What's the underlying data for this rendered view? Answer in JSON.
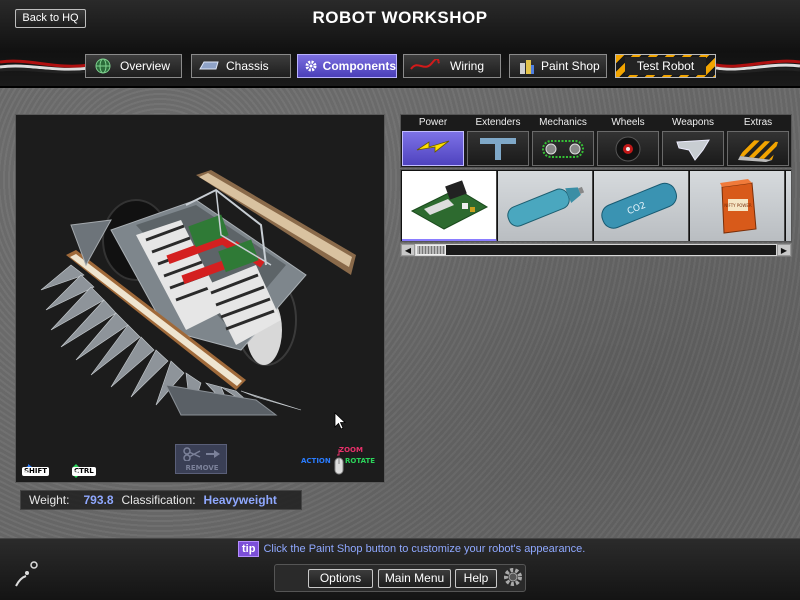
{
  "header": {
    "back_label": "Back to HQ",
    "title": "ROBOT WORKSHOP"
  },
  "tabs": [
    {
      "label": "Overview",
      "icon": "globe-icon"
    },
    {
      "label": "Chassis",
      "icon": "chassis-icon"
    },
    {
      "label": "Components",
      "icon": "gear-icon",
      "active": true
    },
    {
      "label": "Wiring",
      "icon": "wire-icon"
    },
    {
      "label": "Paint Shop",
      "icon": "paint-cans-icon"
    },
    {
      "label": "Test Robot",
      "icon": "hazard-stripes"
    }
  ],
  "viewport": {
    "shift_key": "SHIFT",
    "ctrl_key": "CTRL",
    "remove_label": "REMOVE",
    "action_label": "ACTION",
    "zoom_label": "ZOOM",
    "rotate_label": "ROTATE"
  },
  "stats": {
    "weight_label": "Weight:",
    "weight_value": "793.8",
    "class_label": "Classification:",
    "class_value": "Heavyweight"
  },
  "categories": [
    {
      "label": "Power",
      "icon": "lightning-icon",
      "active": true
    },
    {
      "label": "Extenders",
      "icon": "t-bar-icon"
    },
    {
      "label": "Mechanics",
      "icon": "chain-drive-icon"
    },
    {
      "label": "Wheels",
      "icon": "wheel-icon"
    },
    {
      "label": "Weapons",
      "icon": "blade-icon"
    },
    {
      "label": "Extras",
      "icon": "hazard-plate-icon"
    }
  ],
  "parts": [
    {
      "name": "circuit-board-part",
      "selected": true
    },
    {
      "name": "blue-tank-part"
    },
    {
      "name": "co2-tank-part",
      "text": "CO2"
    },
    {
      "name": "orange-battery-part",
      "text": "NIFTY POWER"
    }
  ],
  "tip": {
    "badge": "tip",
    "text": "Click the Paint Shop button to customize your robot's appearance."
  },
  "menu": {
    "options": "Options",
    "main_menu": "Main Menu",
    "help": "Help"
  },
  "colors": {
    "accent": "#7c6fe0",
    "value_blue": "#8fa8ff",
    "hazard_orange": "#f2a400"
  }
}
